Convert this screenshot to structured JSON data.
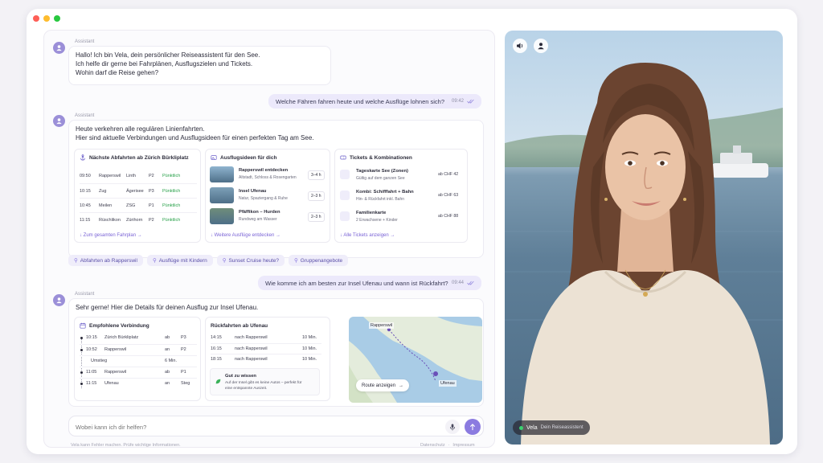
{
  "colors": {
    "accent": "#8b7be0",
    "success": "#27a048",
    "traffic_red": "#fe5f57",
    "traffic_yellow": "#febc2e",
    "traffic_green": "#28c840"
  },
  "messages": {
    "m1": {
      "sender": "Assistant",
      "lines": [
        "Hallo! Ich bin Vela, dein persönlicher Reiseassistent für den See.",
        "Ich helfe dir gerne bei Fahrplänen, Ausflugszielen und Tickets.",
        "Wohin darf die Reise gehen?"
      ]
    },
    "u1": {
      "text": "Welche Fähren fahren heute und welche Ausflüge lohnen sich?",
      "time": "09:42"
    },
    "m2": {
      "sender": "Assistant",
      "lines": [
        "Heute verkehren alle regulären Linienfahrten.",
        "Hier sind aktuelle Verbindungen und Ausflugsideen für einen perfekten Tag am See."
      ]
    },
    "u2": {
      "text": "Wie komme ich am besten zur Insel Ufenau und wann ist Rückfahrt?",
      "time": "09:44"
    },
    "m3": {
      "sender": "Assistant",
      "line": "Sehr gerne! Hier die Details für deinen Ausflug zur Insel Ufenau."
    }
  },
  "departures": {
    "title": "Nächste Abfahrten ab Zürich Bürkliplatz",
    "rows": [
      [
        "09:50",
        "Rapperswil",
        "Linth",
        "P2",
        "Pünktlich"
      ],
      [
        "10:15",
        "Zug",
        "Ägerisee",
        "P3",
        "Pünktlich"
      ],
      [
        "10:45",
        "Meilen",
        "ZSG",
        "P1",
        "Pünktlich"
      ],
      [
        "11:15",
        "Rüschlikon",
        "Zürihorn",
        "P2",
        "Pünktlich"
      ]
    ],
    "link": "Zum gesamten Fahrplan"
  },
  "excursions": {
    "title": "Ausflugsideen für dich",
    "items": [
      {
        "name": "Rapperswil entdecken",
        "desc": "Altstadt, Schloss & Rosengarten",
        "dur": "3–4 h"
      },
      {
        "name": "Insel Ufenau",
        "desc": "Natur, Spaziergang & Ruhe",
        "dur": "2–3 h"
      },
      {
        "name": "Pfäffikon – Hurden",
        "desc": "Rundweg am Wasser",
        "dur": "2–3 h"
      }
    ],
    "link": "Weitere Ausflüge entdecken"
  },
  "tickets": {
    "title": "Tickets & Kombinationen",
    "items": [
      {
        "name": "Tageskarte See (Zonen)",
        "desc": "Gültig auf dem ganzen See",
        "price": "ab CHF 42",
        "icon": "ticket-icon"
      },
      {
        "name": "Kombi: Schifffahrt + Bahn",
        "desc": "Hin- & Rückfahrt inkl. Bahn",
        "price": "ab CHF 63",
        "icon": "train-icon"
      },
      {
        "name": "Familienkarte",
        "desc": "2 Erwachsene + Kinder",
        "price": "ab CHF 88",
        "icon": "family-icon"
      }
    ],
    "link": "Alle Tickets anzeigen"
  },
  "chips": [
    "Abfahrten ab Rapperswil",
    "Ausflüge mit Kindern",
    "Sunset Cruise heute?",
    "Gruppenangebote"
  ],
  "route": {
    "title": "Empfohlene Verbindung",
    "rows": [
      {
        "time": "10:15",
        "place": "Zürich Bürkliplatz",
        "mode": "ab",
        "platform": "P3"
      },
      {
        "time": "10:52",
        "place": "Rapperswil",
        "mode": "an",
        "platform": "P2"
      },
      {
        "time": "",
        "place": "Umstieg",
        "mode": "6 Min.",
        "platform": ""
      },
      {
        "time": "11:05",
        "place": "Rapperswil",
        "mode": "ab",
        "platform": "P1"
      },
      {
        "time": "11:15",
        "place": "Ufenau",
        "mode": "an",
        "platform": "Steg"
      }
    ]
  },
  "returns": {
    "title": "Rückfahrten ab Ufenau",
    "rows": [
      [
        "14:15",
        "nach Rapperswil",
        "10 Min."
      ],
      [
        "16:15",
        "nach Rapperswil",
        "10 Min."
      ],
      [
        "18:15",
        "nach Rapperswil",
        "10 Min."
      ]
    ],
    "tip_title": "Gut zu wissen",
    "tip_lines": [
      "Auf der Insel gibt es keine Autos – perfekt für",
      "eine entspannte Auszeit."
    ]
  },
  "map": {
    "from": "Rapperswil",
    "to": "Ufenau",
    "button": "Route anzeigen"
  },
  "input": {
    "placeholder": "Wobei kann ich dir helfen?"
  },
  "footer": {
    "disclaimer": "Vela kann Fehler machen. Prüfe wichtige Informationen.",
    "privacy": "Datenschutz",
    "imprint": "Impressum"
  },
  "video": {
    "name": "Vela",
    "role": "Dein Reiseassistent"
  }
}
